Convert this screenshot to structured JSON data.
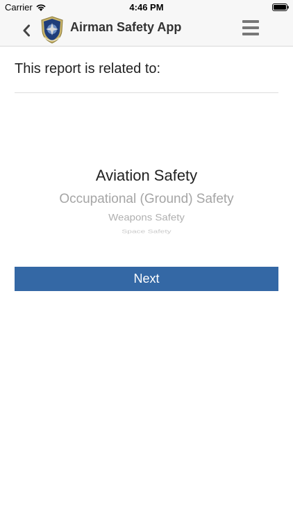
{
  "status_bar": {
    "carrier": "Carrier",
    "time": "4:46 PM"
  },
  "nav": {
    "title": "Airman Safety App",
    "back_icon": "chevron-left-icon",
    "menu_icon": "hamburger-menu-icon"
  },
  "form": {
    "prompt": "This report is related to:",
    "picker_options": [
      "Aviation Safety",
      "Occupational (Ground) Safety",
      "Weapons Safety",
      "Space Safety"
    ],
    "selected_option": "Aviation Safety",
    "next_label": "Next"
  },
  "colors": {
    "nav_background": "#f7f7f7",
    "button_background": "#3468a5",
    "button_text": "#ffffff"
  }
}
